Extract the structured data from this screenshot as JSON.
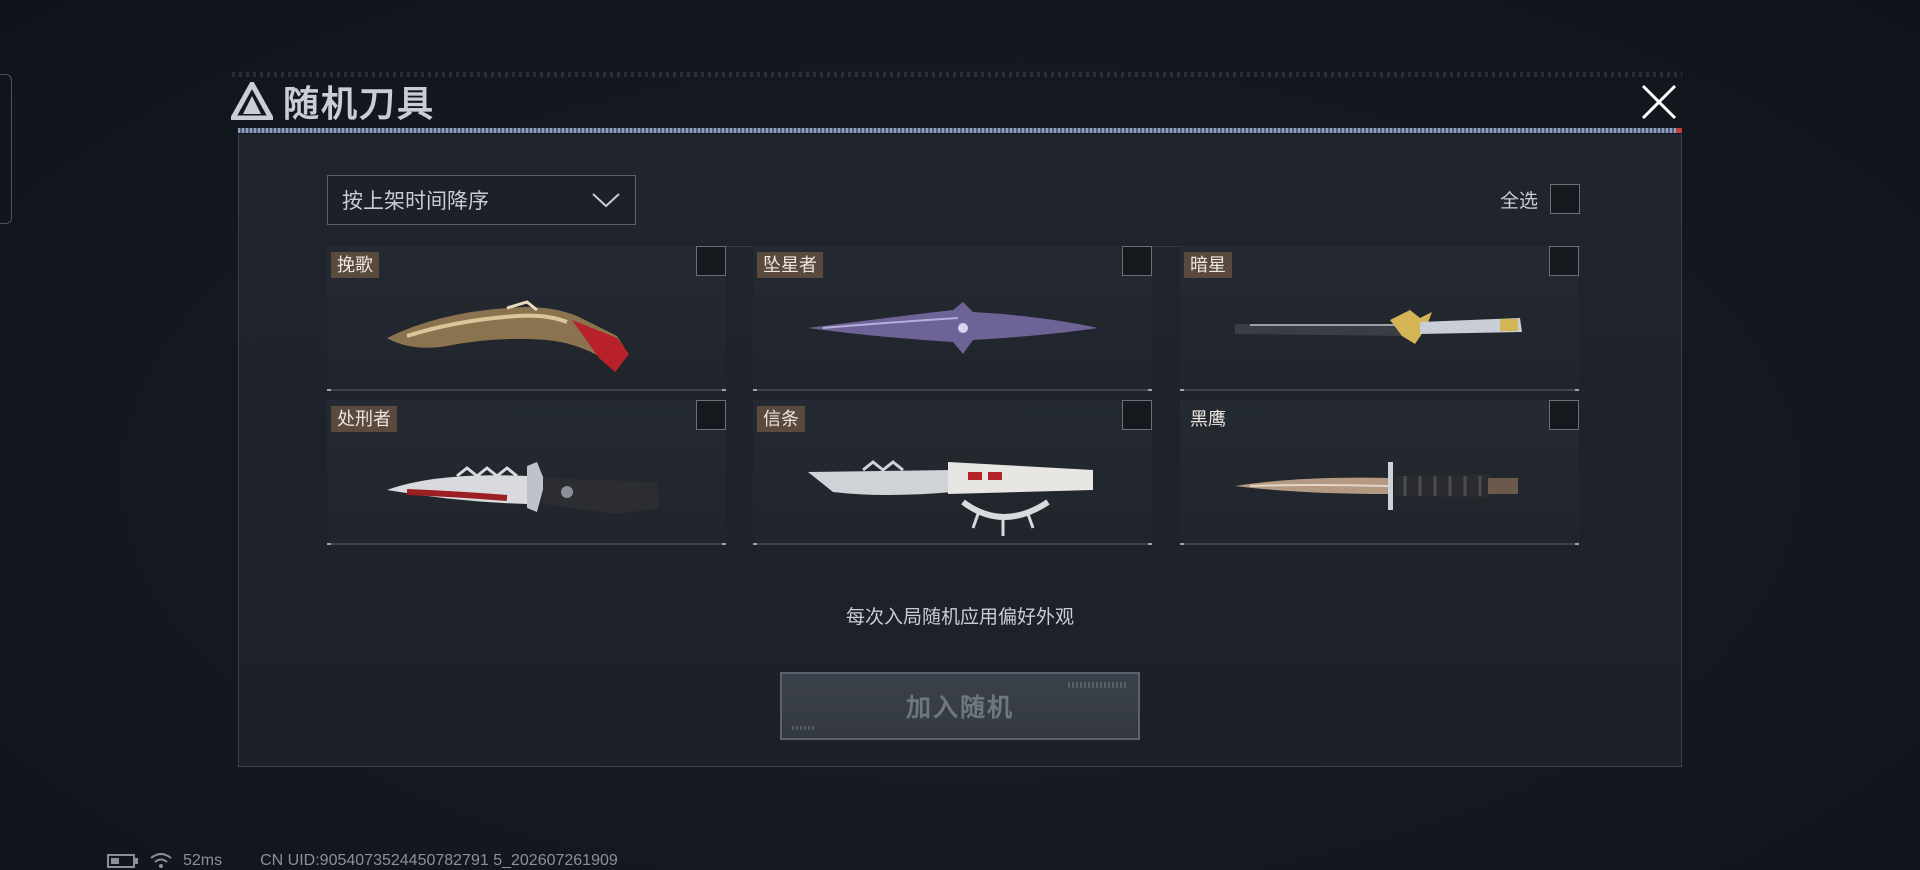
{
  "window": {
    "title": "随机刀具"
  },
  "sort": {
    "selected": "按上架时间降序"
  },
  "select_all": {
    "label": "全选"
  },
  "knives": [
    {
      "name": "挽歌",
      "checked": false
    },
    {
      "name": "坠星者",
      "checked": false
    },
    {
      "name": "暗星",
      "checked": false
    },
    {
      "name": "处刑者",
      "checked": false
    },
    {
      "name": "信条",
      "checked": false
    },
    {
      "name": "黑鹰",
      "checked": false
    }
  ],
  "hint": "每次入局随机应用偏好外观",
  "add_button": {
    "label": "加入随机"
  },
  "status": {
    "ping": "52ms",
    "uid": "CN UID:9054073524450782791 5_202607261909"
  },
  "icons": {
    "logo": "triangle-logo-icon",
    "close": "close-icon",
    "dropdown": "chevron-down-icon",
    "battery": "battery-icon",
    "wifi": "wifi-icon"
  },
  "colors": {
    "accent_red": "#c43c3c",
    "name_tag": "#5a4a3e",
    "panel": "#20252d"
  }
}
